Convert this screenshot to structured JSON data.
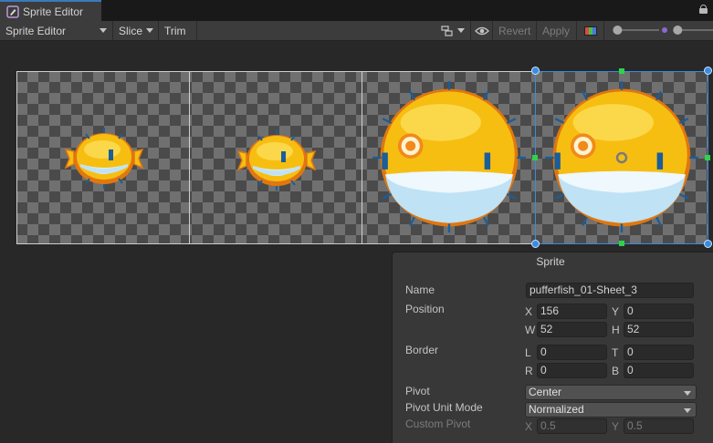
{
  "window": {
    "tab_title": "Sprite Editor"
  },
  "toolbar": {
    "mode_dropdown": "Sprite Editor",
    "slice_label": "Slice",
    "trim_label": "Trim",
    "revert_label": "Revert",
    "apply_label": "Apply",
    "zoom_level": 0.05,
    "mip_level": 0.1
  },
  "canvas": {
    "sprites": [
      {
        "index": 0,
        "size": "small"
      },
      {
        "index": 1,
        "size": "small"
      },
      {
        "index": 2,
        "size": "large"
      },
      {
        "index": 3,
        "size": "large",
        "selected": true
      }
    ]
  },
  "sprite_panel": {
    "title": "Sprite",
    "name_label": "Name",
    "name_value": "pufferfish_01-Sheet_3",
    "position_label": "Position",
    "x_axis": "X",
    "x_value": "156",
    "y_axis": "Y",
    "y_value": "0",
    "w_axis": "W",
    "w_value": "52",
    "h_axis": "H",
    "h_value": "52",
    "border_label": "Border",
    "l_axis": "L",
    "l_value": "0",
    "t_axis": "T",
    "t_value": "0",
    "r_axis": "R",
    "r_value": "0",
    "b_axis": "B",
    "b_value": "0",
    "pivot_label": "Pivot",
    "pivot_value": "Center",
    "pivot_unit_label": "Pivot Unit Mode",
    "pivot_unit_value": "Normalized",
    "custom_pivot_label": "Custom Pivot",
    "cp_x_axis": "X",
    "cp_x_value": "0.5",
    "cp_y_axis": "Y",
    "cp_y_value": "0.5"
  },
  "colors": {
    "accent": "#3a8ce0",
    "fish_body": "#f7be12",
    "fish_belly": "#dff1fb",
    "fish_outline": "#e0770f"
  }
}
